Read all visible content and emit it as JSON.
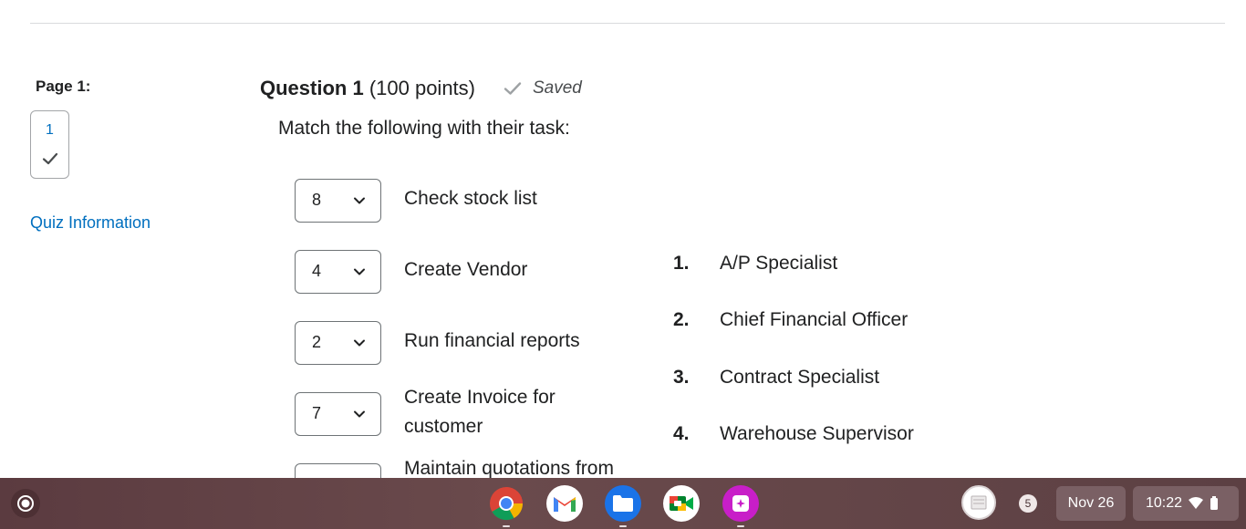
{
  "nav": {
    "page_label": "Page 1:",
    "page_number": "1",
    "quiz_info": "Quiz Information"
  },
  "question": {
    "title_bold": "Question 1",
    "points": "(100 points)",
    "status": "Saved",
    "prompt": "Match the following with their task:"
  },
  "matches": [
    {
      "selected": "8",
      "task": "Check stock list"
    },
    {
      "selected": "4",
      "task": "Create Vendor"
    },
    {
      "selected": "2",
      "task": "Run financial reports"
    },
    {
      "selected": "7",
      "task": "Create Invoice for customer"
    },
    {
      "selected": "",
      "task": "Maintain quotations from"
    }
  ],
  "roles": [
    {
      "num": "1.",
      "name": "A/P Specialist"
    },
    {
      "num": "2.",
      "name": "Chief Financial Officer"
    },
    {
      "num": "3.",
      "name": "Contract Specialist"
    },
    {
      "num": "4.",
      "name": "Warehouse Supervisor"
    }
  ],
  "shelf": {
    "apps": [
      "chrome-icon",
      "gmail-icon",
      "files-icon",
      "meet-icon",
      "tasks-icon"
    ],
    "notification_count": "5",
    "date": "Nov 26",
    "time": "10:22"
  },
  "colors": {
    "link": "#006fbf",
    "shelf": "#5b3b40"
  }
}
